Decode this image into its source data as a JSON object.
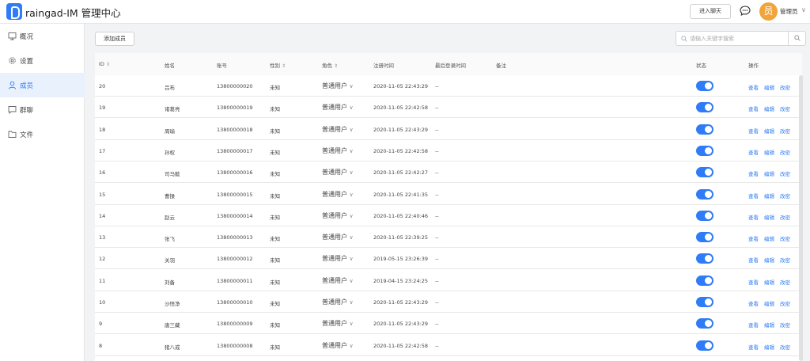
{
  "topbar": {
    "brand": "raingad-IM 管理中心",
    "enter_label": "进入聊天",
    "avatar_char": "员",
    "admin_name": "管理员",
    "admin_caret": "∨"
  },
  "sidebar": {
    "items": [
      {
        "label": "概况",
        "icon": "dashboard-icon"
      },
      {
        "label": "设置",
        "icon": "gear-icon"
      },
      {
        "label": "成员",
        "icon": "user-icon"
      },
      {
        "label": "群聊",
        "icon": "chat-icon"
      },
      {
        "label": "文件",
        "icon": "folder-icon"
      }
    ],
    "active": "成员"
  },
  "toolbar": {
    "add_label": "添加成员",
    "search_placeholder": "请输入关键字搜索"
  },
  "table": {
    "headers": {
      "id": "ID",
      "name": "姓名",
      "account": "账号",
      "gender": "性别",
      "role": "角色",
      "reg_time": "注册时间",
      "last_login": "最后登录时间",
      "remark": "备注",
      "status": "状态",
      "actions": "操作"
    },
    "sort_mark": "⇕",
    "action_labels": {
      "view": "查看",
      "edit": "编辑",
      "password": "改密"
    },
    "rows": [
      {
        "id": "20",
        "name": "吕布",
        "account": "13800000020",
        "gender": "未知",
        "role": "普通用户",
        "reg_time": "2020-11-05 22:43:29",
        "last_login": "--",
        "status": true
      },
      {
        "id": "19",
        "name": "诸葛亮",
        "account": "13800000019",
        "gender": "未知",
        "role": "普通用户",
        "reg_time": "2020-11-05 22:42:58",
        "last_login": "--",
        "status": true
      },
      {
        "id": "18",
        "name": "周瑜",
        "account": "13800000018",
        "gender": "未知",
        "role": "普通用户",
        "reg_time": "2020-11-05 22:43:29",
        "last_login": "--",
        "status": true
      },
      {
        "id": "17",
        "name": "孙权",
        "account": "13800000017",
        "gender": "未知",
        "role": "普通用户",
        "reg_time": "2020-11-05 22:42:58",
        "last_login": "--",
        "status": true
      },
      {
        "id": "16",
        "name": "司马懿",
        "account": "13800000016",
        "gender": "未知",
        "role": "普通用户",
        "reg_time": "2020-11-05 22:42:27",
        "last_login": "--",
        "status": true
      },
      {
        "id": "15",
        "name": "曹操",
        "account": "13800000015",
        "gender": "未知",
        "role": "普通用户",
        "reg_time": "2020-11-05 22:41:35",
        "last_login": "--",
        "status": true
      },
      {
        "id": "14",
        "name": "赵云",
        "account": "13800000014",
        "gender": "未知",
        "role": "普通用户",
        "reg_time": "2020-11-05 22:40:46",
        "last_login": "--",
        "status": true
      },
      {
        "id": "13",
        "name": "张飞",
        "account": "13800000013",
        "gender": "未知",
        "role": "普通用户",
        "reg_time": "2020-11-05 22:39:25",
        "last_login": "--",
        "status": true
      },
      {
        "id": "12",
        "name": "关羽",
        "account": "13800000012",
        "gender": "未知",
        "role": "普通用户",
        "reg_time": "2019-05-15 23:26:39",
        "last_login": "--",
        "status": true
      },
      {
        "id": "11",
        "name": "刘备",
        "account": "13800000011",
        "gender": "未知",
        "role": "普通用户",
        "reg_time": "2019-04-15 23:24:25",
        "last_login": "--",
        "status": true
      },
      {
        "id": "10",
        "name": "沙悟净",
        "account": "13800000010",
        "gender": "未知",
        "role": "普通用户",
        "reg_time": "2020-11-05 22:43:29",
        "last_login": "--",
        "status": true
      },
      {
        "id": "9",
        "name": "唐三藏",
        "account": "13800000009",
        "gender": "未知",
        "role": "普通用户",
        "reg_time": "2020-11-05 22:43:29",
        "last_login": "--",
        "status": true
      },
      {
        "id": "8",
        "name": "猪八戒",
        "account": "13800000008",
        "gender": "未知",
        "role": "普通用户",
        "reg_time": "2020-11-05 22:42:58",
        "last_login": "--",
        "status": true
      }
    ]
  },
  "colors": {
    "accent": "#2f7cf6",
    "avatar": "#f0a43a"
  }
}
